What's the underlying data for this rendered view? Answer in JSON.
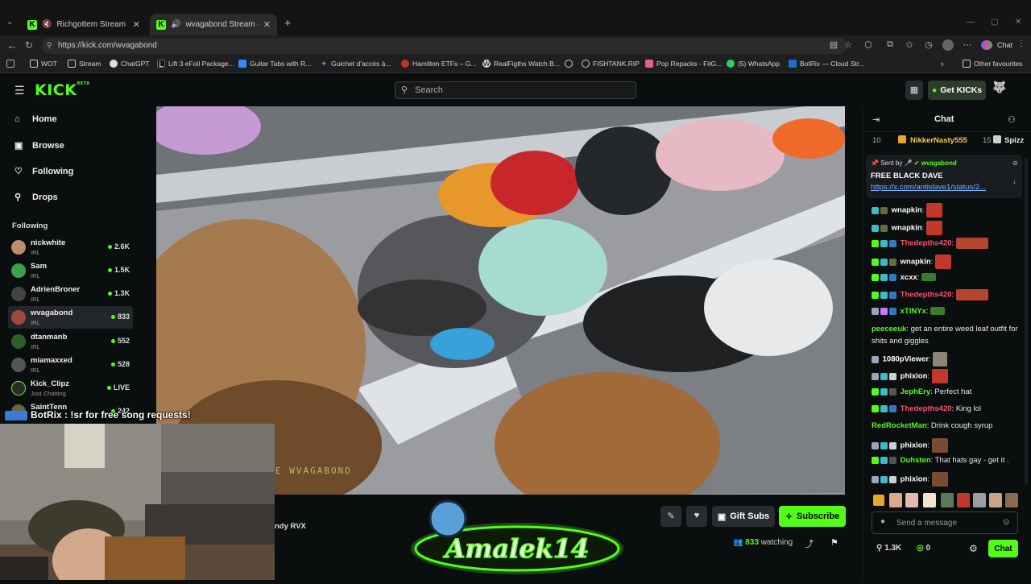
{
  "browser": {
    "tabs": [
      {
        "title": "Richgottem Stream - Watch Li"
      },
      {
        "title": "wvagabond Stream - Watch Li"
      }
    ],
    "url": "https://kick.com/wvagabond",
    "chat_button": "Chat",
    "bookmarks": [
      "WOT",
      "Stream",
      "ChatGPT",
      "Lift 3 eFoil Package...",
      "Guitar Tabs with R...",
      "Guichet d'accès à...",
      "Hamilton ETFs – G...",
      "RealFigths Watch B...",
      "",
      "FISHTANK.RIP",
      "Pop Repacks - FitG...",
      "(5) WhatsApp",
      "BotRix — Cloud Str...",
      "Other favourites"
    ]
  },
  "header": {
    "logo": "KICK",
    "logo_badge": "BETA",
    "search_placeholder": "Search",
    "get_kicks": "Get KICKs"
  },
  "sidebar": {
    "nav": [
      {
        "label": "Home",
        "icon": "home-icon"
      },
      {
        "label": "Browse",
        "icon": "browse-icon"
      },
      {
        "label": "Following",
        "icon": "heart-icon"
      },
      {
        "label": "Drops",
        "icon": "drops-icon"
      }
    ],
    "following_heading": "Following",
    "following": [
      {
        "name": "nickwhite",
        "category": "IRL",
        "count": "2.6K"
      },
      {
        "name": "Sam",
        "category": "IRL",
        "count": "1.5K"
      },
      {
        "name": "AdrienBroner",
        "category": "IRL",
        "count": "1.3K"
      },
      {
        "name": "wvagabond",
        "category": "IRL",
        "count": "833"
      },
      {
        "name": "dtanmanb",
        "category": "IRL",
        "count": "552"
      },
      {
        "name": "miamaxxed",
        "category": "IRL",
        "count": "528"
      },
      {
        "name": "Kick_Clipz",
        "category": "Just Chatting",
        "count": "LIVE"
      },
      {
        "name": "SaintTenn",
        "category": "",
        "count": "242"
      }
    ]
  },
  "video": {
    "watermark": "E WVAGABOND",
    "streamer_partial": "ndy RVX",
    "gift_subs": "Gift Subs",
    "subscribe": "Subscribe",
    "watching_count": "833",
    "watching_label": "watching"
  },
  "overlay": {
    "botrix_text": "BotRix : !sr for free song requests!",
    "logo_text": "Amalek14"
  },
  "chat": {
    "title": "Chat",
    "top_gifter_rank": "10",
    "top_gifter_name": "NikkerNasty555",
    "top_gifter_count": "15",
    "top_gifter2": "Spizz",
    "pinned_sent_by_label": "Sent by",
    "pinned_sent_by": "wvagabond",
    "pinned_message": "FREE BLACK DAVE",
    "pinned_link": "https://x.com/antislave1/status/2...",
    "messages": [
      {
        "user": "wnapkin",
        "text": "",
        "color": "#ffffff"
      },
      {
        "user": "wnapkin",
        "text": "",
        "color": "#ffffff"
      },
      {
        "user": "Thedepths420",
        "text": "",
        "color": "#ff4d6d"
      },
      {
        "user": "wnapkin",
        "text": "",
        "color": "#ffffff"
      },
      {
        "user": "xcxx",
        "text": "",
        "color": "#ffffff"
      },
      {
        "user": "Thedepths420",
        "text": "",
        "color": "#ff4d6d"
      },
      {
        "user": "xTINYx",
        "text": "",
        "color": "#53fc18"
      },
      {
        "user": "peeceeuk",
        "text": "get an entire weed leaf outfit for shits and giggles",
        "color": "#53fc18"
      },
      {
        "user": "1080pViewer",
        "text": "",
        "color": "#ffffff"
      },
      {
        "user": "phixion",
        "text": "",
        "color": "#ffffff"
      },
      {
        "user": "JephEry",
        "text": "Perfect hat",
        "color": "#53fc18"
      },
      {
        "user": "Thedepths420",
        "text": "King lol",
        "color": "#ff4d6d"
      },
      {
        "user": "RedRocketMan",
        "text": "Drink cough syrup",
        "color": "#53fc18"
      },
      {
        "user": "phixion",
        "text": "",
        "color": "#ffffff"
      },
      {
        "user": "Duhsten",
        "text": "That hats gay - get it .",
        "color": "#53fc18"
      },
      {
        "user": "phixion",
        "text": "",
        "color": "#ffffff"
      }
    ],
    "input_placeholder": "Send a message",
    "kicks_count": "1.3K",
    "points_count": "0",
    "send_button": "Chat"
  },
  "colors": {
    "brand": "#53fc18",
    "background": "#0b0e0f"
  }
}
